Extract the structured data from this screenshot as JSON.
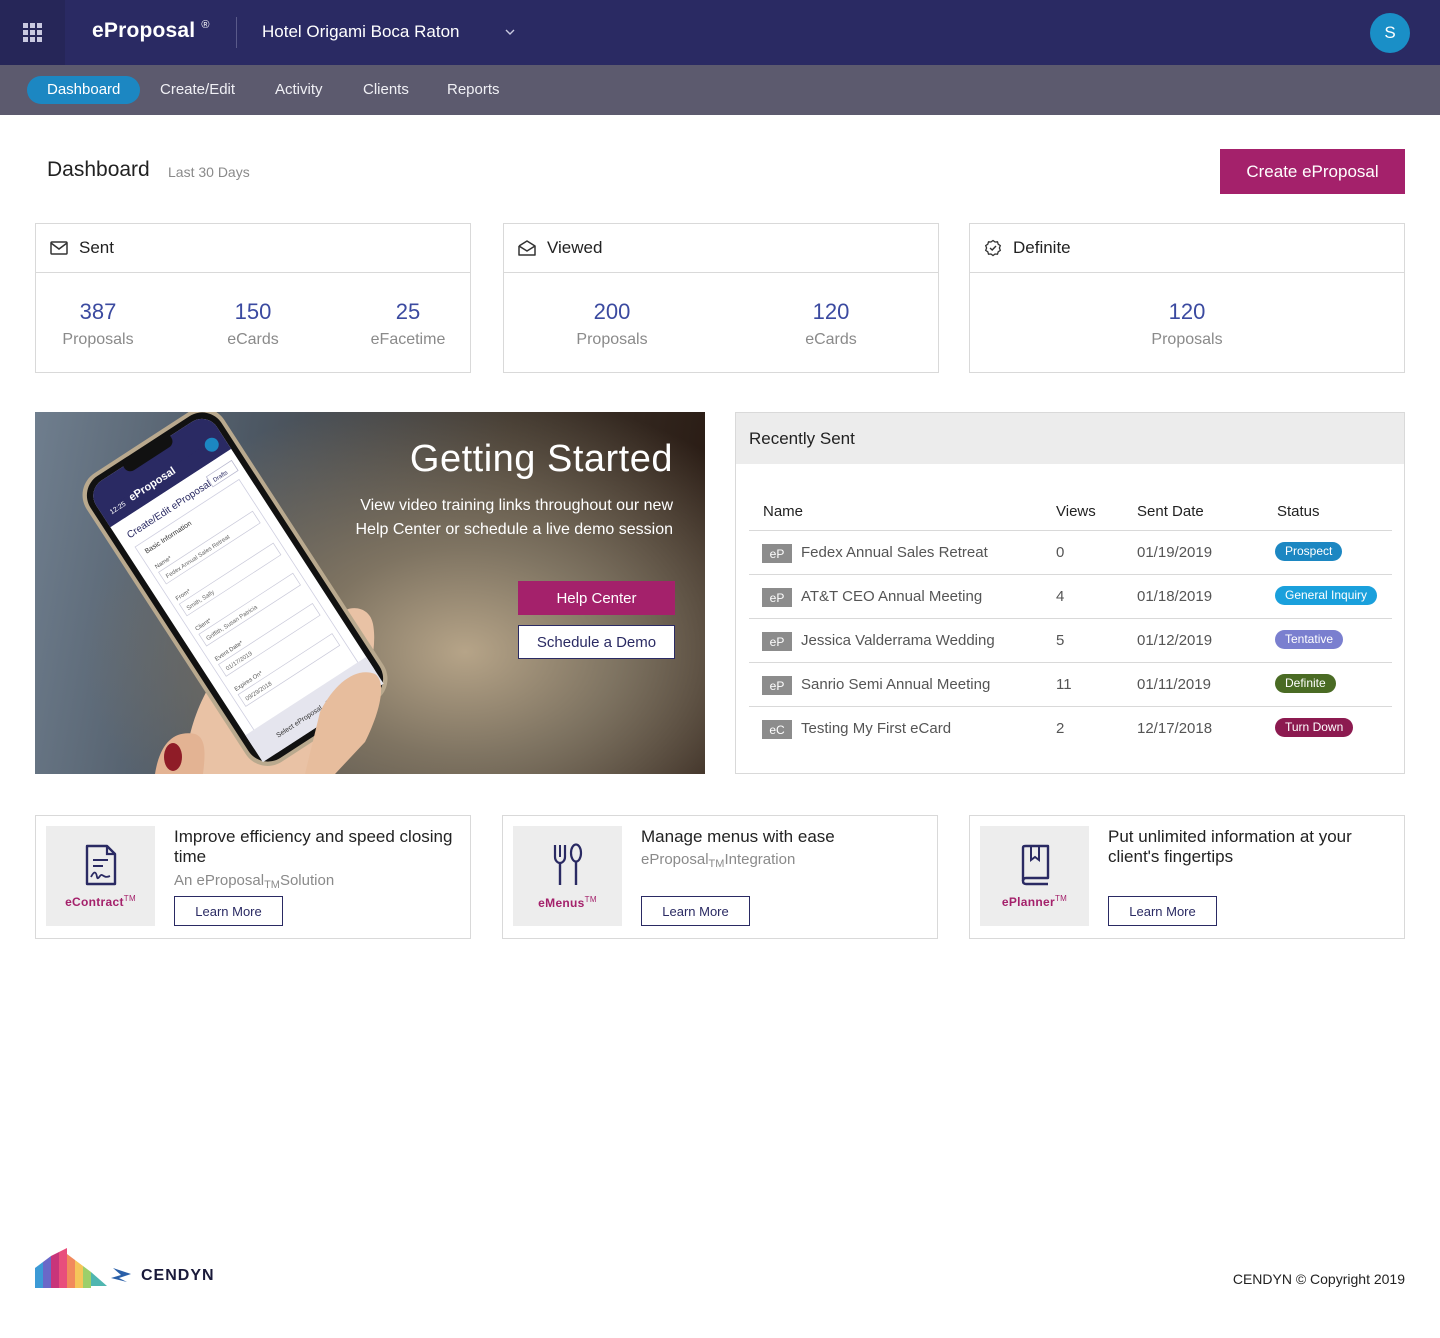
{
  "app": {
    "brand": "eProposal",
    "brand_mark": "®",
    "hotel": "Hotel Origami Boca Raton",
    "user_initial": "S"
  },
  "nav": {
    "items": [
      "Dashboard",
      "Create/Edit",
      "Activity",
      "Clients",
      "Reports"
    ],
    "active": "Dashboard"
  },
  "header": {
    "title": "Dashboard",
    "period": "Last 30 Days",
    "create_label": "Create eProposal"
  },
  "stats": {
    "sent": {
      "title": "Sent",
      "icon": "envelope-icon",
      "items": [
        {
          "value": "387",
          "label": "Proposals"
        },
        {
          "value": "150",
          "label": "eCards"
        },
        {
          "value": "25",
          "label": "eFacetime"
        }
      ]
    },
    "viewed": {
      "title": "Viewed",
      "icon": "open-envelope-icon",
      "items": [
        {
          "value": "200",
          "label": "Proposals"
        },
        {
          "value": "120",
          "label": "eCards"
        }
      ]
    },
    "definite": {
      "title": "Definite",
      "icon": "check-badge-icon",
      "items": [
        {
          "value": "120",
          "label": "Proposals"
        }
      ]
    }
  },
  "hero": {
    "title": "Getting Started",
    "text": "View video training links throughout our new Help Center or schedule a live demo session",
    "help_label": "Help Center",
    "demo_label": "Schedule a Demo",
    "phone": {
      "brand": "eProposal",
      "time": "12:25",
      "heading": "Create/Edit eProposal",
      "drafts": "Drafts",
      "section": "Basic Information",
      "name_label": "Name*",
      "name_value": "Fedex Annual Sales Retreat",
      "from_label": "From*",
      "from_value": "Smith, Sally",
      "client_label": "Client*",
      "client_value": "Griffith, Susan Patricia",
      "event_label": "Event Date*",
      "event_value": "01/17/2019",
      "expires_label": "Expires On*",
      "expires_value": "09/29/2018",
      "footer": "Select eProposal - Property"
    }
  },
  "recent": {
    "title": "Recently Sent",
    "columns": [
      "Name",
      "Views",
      "Sent Date",
      "Status"
    ],
    "rows": [
      {
        "tag": "eP",
        "name": "Fedex Annual Sales Retreat",
        "views": "0",
        "date": "01/19/2019",
        "status": "Prospect",
        "color": "#1c87c2"
      },
      {
        "tag": "eP",
        "name": "AT&T CEO Annual Meeting",
        "views": "4",
        "date": "01/18/2019",
        "status": "General Inquiry",
        "color": "#1aa0dc"
      },
      {
        "tag": "eP",
        "name": "Jessica Valderrama Wedding",
        "views": "5",
        "date": "01/12/2019",
        "status": "Tentative",
        "color": "#7a7fcf"
      },
      {
        "tag": "eP",
        "name": "Sanrio Semi Annual Meeting",
        "views": "11",
        "date": "01/11/2019",
        "status": "Definite",
        "color": "#4a6b24"
      },
      {
        "tag": "eC",
        "name": "Testing My First eCard",
        "views": "2",
        "date": "12/17/2018",
        "status": "Turn Down",
        "color": "#8c1a50"
      }
    ]
  },
  "promos": [
    {
      "product": "eContract",
      "tm": "TM",
      "icon": "contract-document-icon",
      "title": "Improve efficiency and speed closing time",
      "sub_pre": "An eProposal",
      "sub_tm": "TM",
      "sub_post": "Solution",
      "button": "Learn More"
    },
    {
      "product": "eMenus",
      "tm": "TM",
      "icon": "fork-spoon-icon",
      "title": "Manage menus with ease",
      "sub_pre": "eProposal",
      "sub_tm": "TM",
      "sub_post": "Integration",
      "button": "Learn More"
    },
    {
      "product": "ePlanner",
      "tm": "TM",
      "icon": "planner-book-icon",
      "title": "Put unlimited information at your client's fingertips",
      "button": "Learn More"
    }
  ],
  "footer": {
    "logo": "CENDYN",
    "copyright": "CENDYN © Copyright 2019"
  },
  "colors": {
    "topbar": "#2a2a63",
    "navbar": "#5c5a6e",
    "accent": "#a4216b",
    "active_nav": "#1c87c2",
    "stat_number": "#3b4aa0"
  }
}
